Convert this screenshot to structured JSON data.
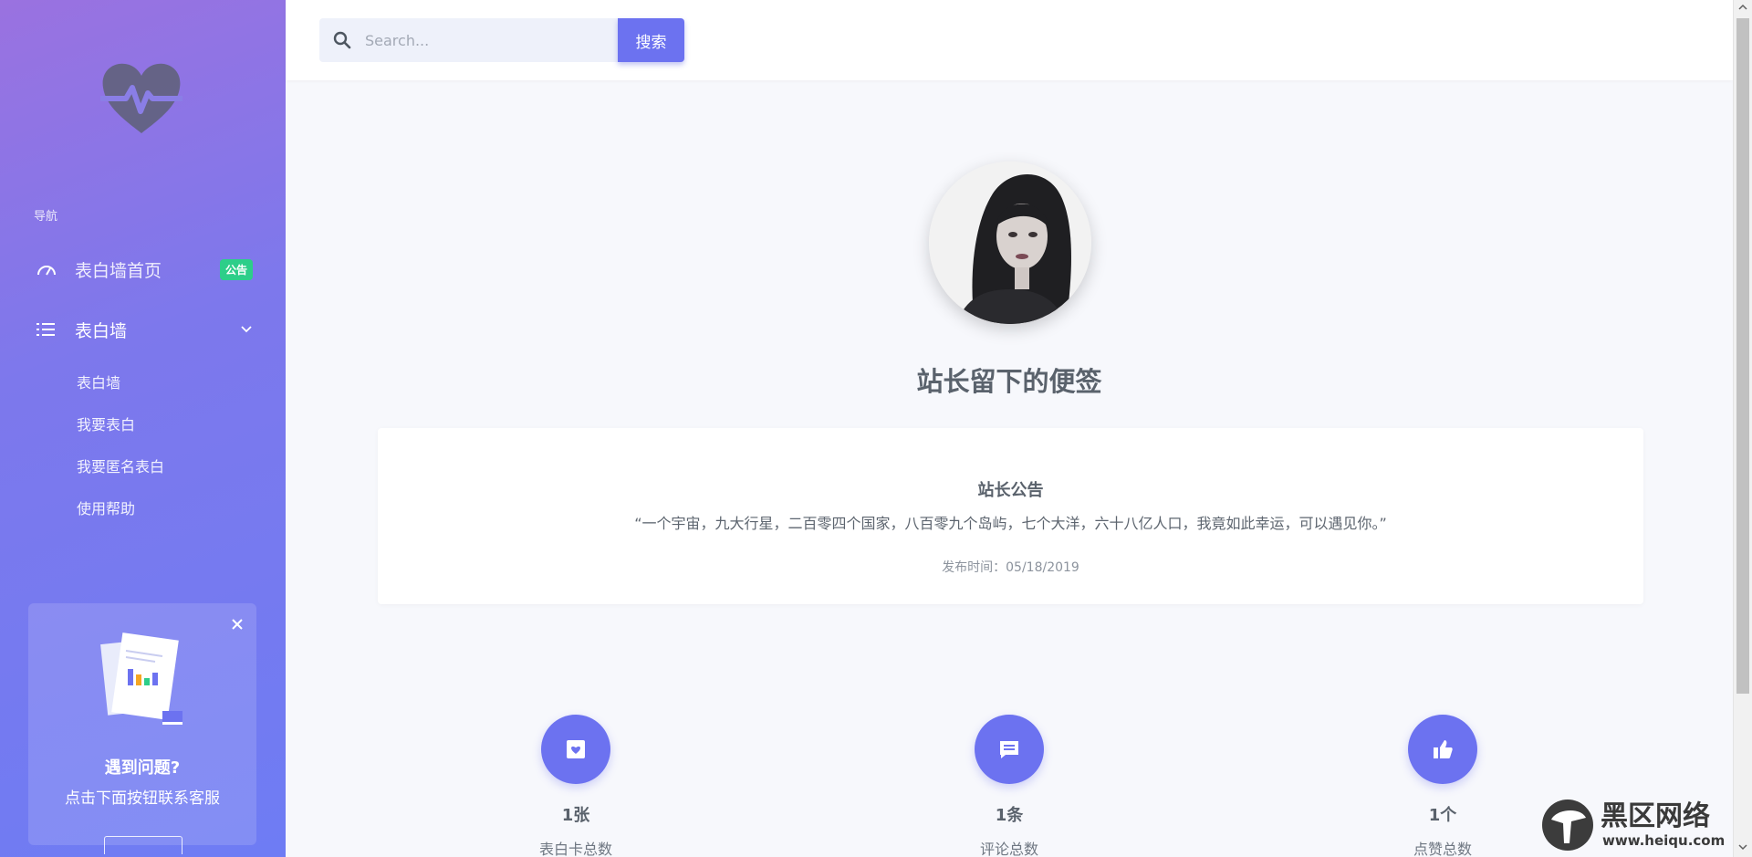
{
  "sidebar": {
    "nav_heading": "导航",
    "nav_items": [
      {
        "label": "表白墙首页",
        "badge": "公告",
        "icon": "dashboard-gauge-icon"
      },
      {
        "label": "表白墙",
        "icon": "list-icon",
        "expanded": true
      }
    ],
    "sub_items": [
      "表白墙",
      "我要表白",
      "我要匿名表白",
      "使用帮助"
    ],
    "help_card": {
      "title": "遇到问题?",
      "subtitle": "点击下面按钮联系客服"
    }
  },
  "topbar": {
    "search_placeholder": "Search...",
    "search_button": "搜索"
  },
  "main": {
    "title": "站长留下的便签",
    "notice": {
      "title": "站长公告",
      "quote": "“一个宇宙，九大行星，二百零四个国家，八百零九个岛屿，七个大洋，六十八亿人口，我竟如此幸运，可以遇见你。”",
      "time": "发布时间：05/18/2019"
    },
    "stats": [
      {
        "value": "1张",
        "label": "表白卡总数",
        "icon": "card-heart-icon"
      },
      {
        "value": "1条",
        "label": "评论总数",
        "icon": "comment-icon"
      },
      {
        "value": "1个",
        "label": "点赞总数",
        "icon": "thumbs-up-icon"
      }
    ]
  },
  "watermark": {
    "text": "黑区网络",
    "url": "www.heiqu.com"
  },
  "colors": {
    "accent": "#6c72f0",
    "badge_green": "#2dce89",
    "sidebar_gradient_start": "#9a72e0",
    "sidebar_gradient_end": "#6e7cf4"
  }
}
